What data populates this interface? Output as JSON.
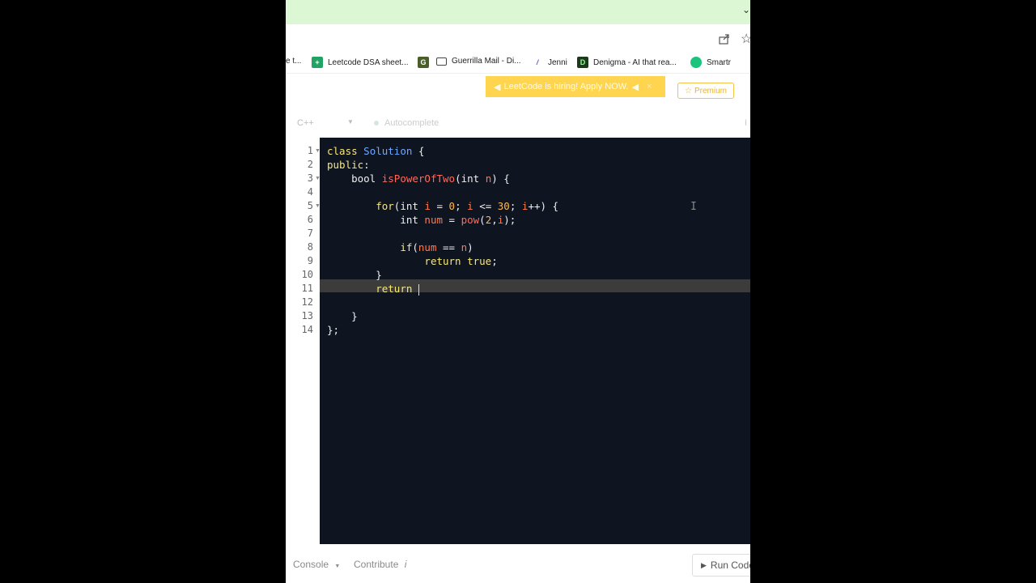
{
  "browser": {
    "chevron": "⌄",
    "bookmarks": [
      {
        "label": "e t...",
        "icon": "",
        "color": "#ffffff"
      },
      {
        "label": "Leetcode DSA sheet...",
        "icon": "+",
        "color": "#1fa463"
      },
      {
        "label": "",
        "icon": "G",
        "color": "#4a5e2a"
      },
      {
        "label": "Guerrilla Mail - Di...",
        "icon": "",
        "color": "#ffffff"
      },
      {
        "label": "Jenni",
        "icon": "",
        "color": "#ffffff"
      },
      {
        "label": "Denigma - AI that rea...",
        "icon": "D",
        "color": "#1b3a1b"
      },
      {
        "label": "Smartr",
        "icon": "",
        "color": "#1bc47d"
      }
    ]
  },
  "leetcode": {
    "banner": "LeetCode is hiring! Apply NOW.",
    "banner_close": "×",
    "premium": "Premium"
  },
  "toolbar": {
    "language": "C++",
    "autocomplete": "Autocomplete",
    "end": "I"
  },
  "editor": {
    "line_numbers": [
      "1",
      "2",
      "3",
      "4",
      "5",
      "6",
      "7",
      "8",
      "9",
      "10",
      "11",
      "12",
      "13",
      "14"
    ],
    "fold_lines": [
      1,
      3,
      5
    ],
    "active_line": 11,
    "ibeam": "I"
  },
  "footer": {
    "console": "Console",
    "contribute": "Contribute",
    "contribute_icon": "i",
    "run_code": "Run Code"
  },
  "colors": {
    "editor_bg": "#0f1421",
    "banner_bg": "#ffd54f",
    "premium": "#e8b432"
  }
}
